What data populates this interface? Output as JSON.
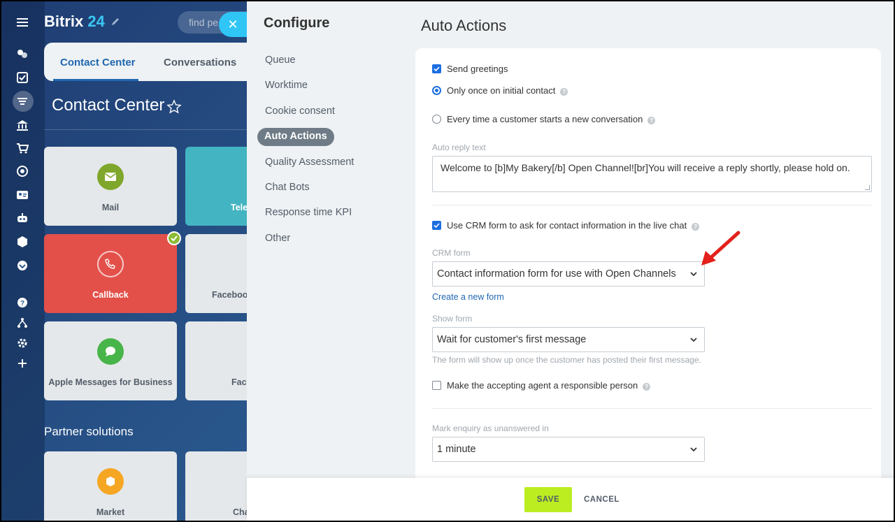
{
  "background": {
    "brand_name": "Bitrix",
    "brand_number": "24",
    "search_placeholder": "find pe",
    "tabs": [
      "Contact Center",
      "Conversations"
    ],
    "page_title": "Contact Center",
    "tiles": [
      "Mail",
      "Tele",
      "Callback",
      "Faceboo",
      "Apple Messages for Business",
      "Fac"
    ],
    "partner_heading": "Partner solutions",
    "partner_tiles": [
      "Market",
      "Cha"
    ]
  },
  "slider": {
    "title": "Configure",
    "menu": [
      "Queue",
      "Worktime",
      "Cookie consent",
      "Auto Actions",
      "Quality Assessment",
      "Chat Bots",
      "Response time KPI",
      "Other"
    ],
    "active_menu": "Auto Actions",
    "section_title": "Auto Actions",
    "send_greetings": {
      "label": "Send greetings",
      "checked": true
    },
    "greeting_mode": {
      "option_once": "Only once on initial contact",
      "option_every": "Every time a customer starts a new conversation",
      "selected": "Only once on initial contact"
    },
    "auto_reply": {
      "label": "Auto reply text",
      "value": "Welcome to [b]My Bakery[/b] Open Channel![br]You will receive a reply shortly, please hold on."
    },
    "use_crm_form": {
      "label": "Use CRM form to ask for contact information in the live chat",
      "checked": true
    },
    "crm_form": {
      "label": "CRM form",
      "value": "Contact information form for use with Open Channels",
      "create_link": "Create a new form"
    },
    "show_form": {
      "label": "Show form",
      "value": "Wait for customer's first message",
      "hint": "The form will show up once the customer has posted their first message."
    },
    "responsible_person": {
      "label": "Make the accepting agent a responsible person",
      "checked": false
    },
    "unanswered": {
      "label": "Mark enquiry as unanswered in",
      "value": "1 minute"
    },
    "footer": {
      "save": "SAVE",
      "cancel": "CANCEL"
    },
    "colors": {
      "accent": "#1c6ee0",
      "save_button": "#bbed21",
      "annotation_arrow": "#e3201b"
    }
  }
}
